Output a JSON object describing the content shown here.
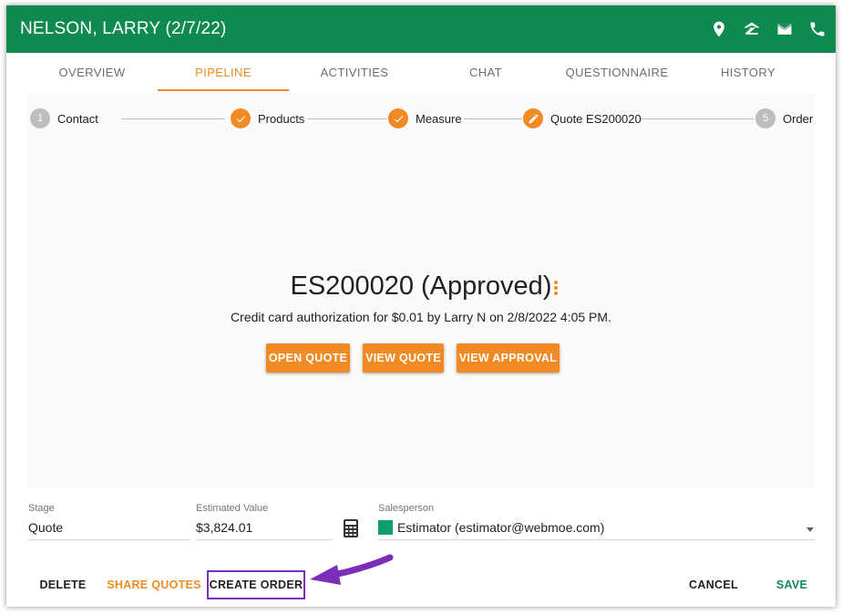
{
  "header": {
    "title": "NELSON, LARRY (2/7/22)",
    "bg_color": "#0f8a4f",
    "icons": [
      "location-pin-icon",
      "zillow-icon",
      "mail-icon",
      "phone-icon"
    ]
  },
  "tabs": [
    {
      "label": "OVERVIEW",
      "active": false
    },
    {
      "label": "PIPELINE",
      "active": true
    },
    {
      "label": "ACTIVITIES",
      "active": false
    },
    {
      "label": "CHAT",
      "active": false
    },
    {
      "label": "QUESTIONNAIRE",
      "active": false
    },
    {
      "label": "HISTORY",
      "active": false
    }
  ],
  "stepper": {
    "steps": [
      {
        "number": "1",
        "label": "Contact",
        "state": "pending"
      },
      {
        "number": "",
        "label": "Products",
        "state": "done"
      },
      {
        "number": "",
        "label": "Measure",
        "state": "done"
      },
      {
        "number": "",
        "label": "Quote ES200020",
        "state": "editing"
      },
      {
        "number": "5",
        "label": "Order",
        "state": "pending"
      }
    ]
  },
  "quote": {
    "title": "ES200020 (Approved)",
    "auth_text": "Credit card authorization for $0.01 by Larry N on 2/8/2022 4:05 PM.",
    "buttons": {
      "open": "OPEN QUOTE",
      "view": "VIEW QUOTE",
      "approval": "VIEW APPROVAL"
    }
  },
  "fields": {
    "stage_label": "Stage",
    "stage_value": "Quote",
    "estimated_label": "Estimated Value",
    "estimated_value": "$3,824.01",
    "salesperson_label": "Salesperson",
    "salesperson_value": "Estimator (estimator@webmoe.com)",
    "salesperson_color": "#0f9d6b"
  },
  "footer": {
    "delete": "DELETE",
    "share": "SHARE QUOTES",
    "create_order": "CREATE ORDER",
    "cancel": "CANCEL",
    "save": "SAVE"
  },
  "colors": {
    "accent": "#f28a24",
    "brand_green": "#0f8a4f",
    "annotation": "#7b2fb8"
  }
}
